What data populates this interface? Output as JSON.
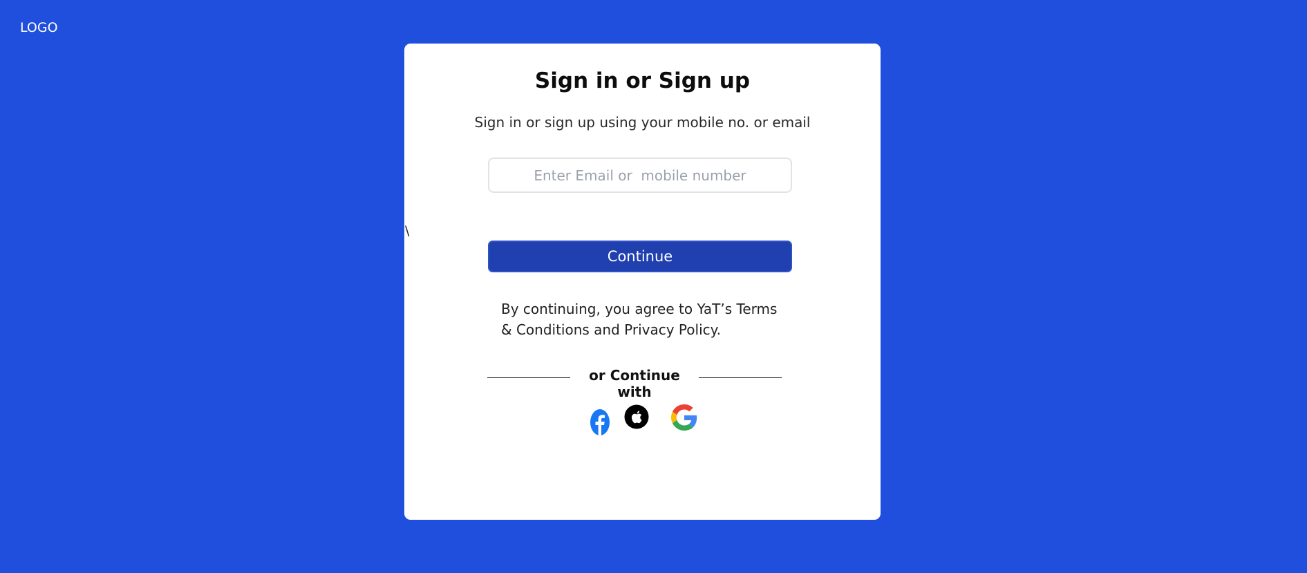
{
  "header": {
    "logo_text": "LOGO"
  },
  "card": {
    "title": "Sign in or Sign up",
    "subtitle": "Sign in or sign up using your mobile no. or email",
    "input_placeholder": "Enter Email or  mobile number",
    "input_value": "",
    "stray_text": "\\",
    "continue_label": "Continue",
    "terms_text": "By continuing, you agree to YaT’s Terms & Conditions and Privacy Policy.",
    "divider_text": "or Continue with",
    "social_icons": [
      "facebook-icon",
      "apple-icon",
      "google-icon"
    ]
  },
  "colors": {
    "background": "#1f4fdc",
    "card": "#ffffff",
    "button": "#2040b0",
    "facebook": "#1877f2"
  }
}
